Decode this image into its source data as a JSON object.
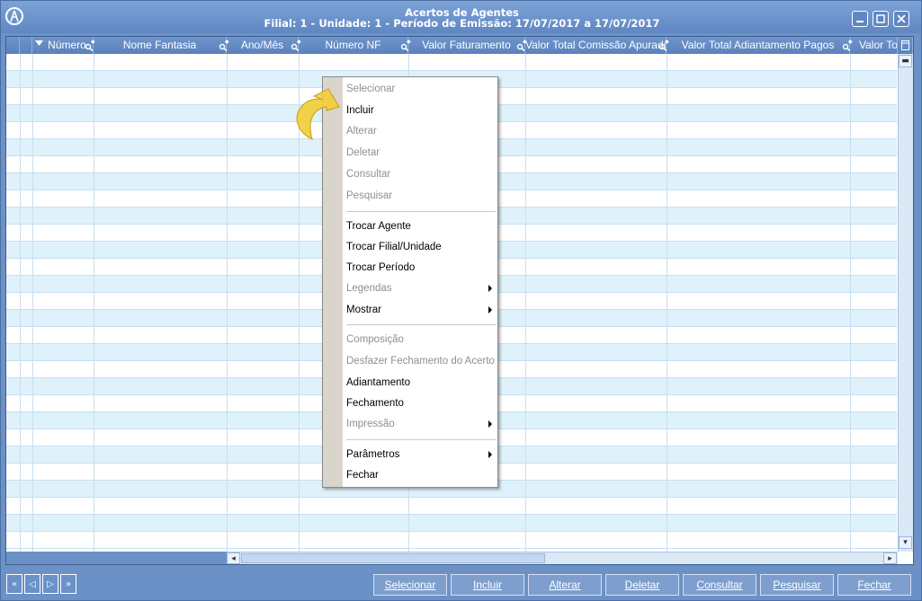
{
  "window": {
    "title_line1": "Acertos de Agentes",
    "title_line2": "Filial: 1 - Unidade: 1 - Período de Emissão: 17/07/2017 a 17/07/2017",
    "controls": [
      "minimize",
      "maximize",
      "close"
    ]
  },
  "grid": {
    "columns": [
      "Número",
      "Nome Fantasia",
      "Ano/Mês",
      "Número NF",
      "Valor Faturamento",
      "Valor Total Comissão Apurado",
      "Valor Total Adiantamento Pagos",
      "Valor Tot"
    ],
    "row_count": 29
  },
  "context_menu": {
    "items": [
      {
        "label": "Selecionar",
        "enabled": false
      },
      {
        "label": "Incluir",
        "enabled": true
      },
      {
        "label": "Alterar",
        "enabled": false
      },
      {
        "label": "Deletar",
        "enabled": false
      },
      {
        "label": "Consultar",
        "enabled": false
      },
      {
        "label": "Pesquisar",
        "enabled": false
      },
      {
        "label": "Trocar Agente",
        "enabled": true
      },
      {
        "label": "Trocar Filial/Unidade",
        "enabled": true
      },
      {
        "label": "Trocar Período",
        "enabled": true
      },
      {
        "label": "Legendas",
        "enabled": false,
        "submenu": true
      },
      {
        "label": "Mostrar",
        "enabled": true,
        "submenu": true
      },
      {
        "label": "Composição",
        "enabled": false
      },
      {
        "label": "Desfazer Fechamento do Acerto",
        "enabled": false
      },
      {
        "label": "Adiantamento",
        "enabled": true
      },
      {
        "label": "Fechamento",
        "enabled": true
      },
      {
        "label": "Impressão",
        "enabled": false,
        "submenu": true
      },
      {
        "label": "Parâmetros",
        "enabled": true,
        "submenu": true
      },
      {
        "label": "Fechar",
        "enabled": true
      }
    ]
  },
  "footer": {
    "buttons": [
      "Selecionar",
      "Incluir",
      "Alterar",
      "Deletar",
      "Consultar",
      "Pesquisar",
      "Fechar"
    ]
  },
  "colors": {
    "window": "#6b91c7",
    "row_alt": "#dff2fb",
    "menu_strip": "#d9d5cb",
    "pointer": "#f2cf3a"
  }
}
